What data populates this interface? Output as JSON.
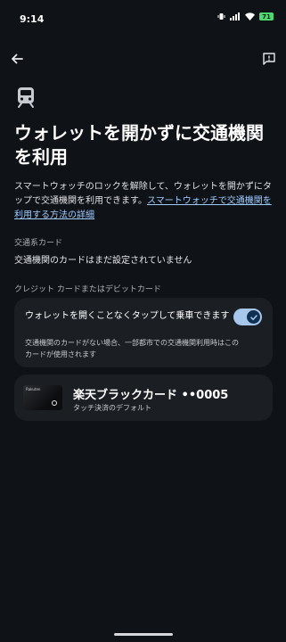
{
  "status_bar": {
    "time": "9:14",
    "battery": "71"
  },
  "page": {
    "title": "ウォレットを開かずに交通機関を利用",
    "description": "スマートウォッチのロックを解除して、ウォレットを開かずにタップで交通機関を利用できます。",
    "details_link": "スマートウォッチで交通機関を利用する方法の詳細"
  },
  "transit_section": {
    "label": "交通系カード",
    "empty_text": "交通機関のカードはまだ設定されていません"
  },
  "credit_section": {
    "label": "クレジット カードまたはデビットカード",
    "toggle_title": "ウォレットを開くことなくタップして乗車できます",
    "toggle_description": "交通機関のカードがない場合、一部都市での交通機関利用時はこのカードが使用されます",
    "toggle_on": true
  },
  "payment_card": {
    "brand": "Rakuten",
    "name": "楽天ブラックカード ••0005",
    "subtitle": "タッチ決済のデフォルト"
  },
  "icons": {
    "back": "arrow-back-icon",
    "feedback": "feedback-icon",
    "transit": "train-icon",
    "toggle_check": "check-icon"
  },
  "colors": {
    "background": "#0f1216",
    "card": "#1b1f24",
    "link": "#9ecbff",
    "toggle_track": "#a7c8ea",
    "battery": "#4dd96f"
  }
}
